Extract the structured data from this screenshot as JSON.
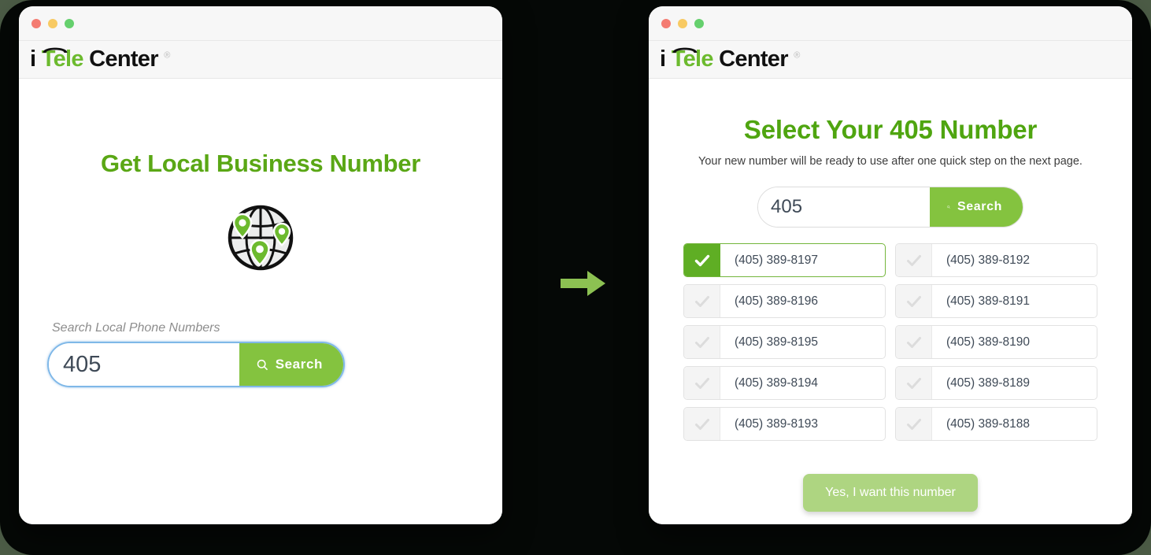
{
  "background": {
    "page_color": "#4c5c46",
    "panel_color": "#050806"
  },
  "theme": {
    "green_accent": "#84c33f",
    "green_heading": "#5aa715",
    "green_check": "#5fae24",
    "cta_green": "#aed581",
    "focus_blue": "#7fb8e8",
    "text_dark": "#3f4a57"
  },
  "logo": {
    "part_i": "i",
    "part_tele": "Tele",
    "part_center": "Center",
    "registered": "®",
    "handset_icon": "phone-handset-icon"
  },
  "window_controls": {
    "close": "close-dot",
    "minimize": "minimize-dot",
    "maximize": "maximize-dot"
  },
  "left_window": {
    "heading": "Get Local Business Number",
    "globe_icon": "globe-with-location-pins-icon",
    "field_label": "Search Local Phone Numbers",
    "search": {
      "value": "405",
      "placeholder": "Area code",
      "button_label": "Search",
      "icon": "search-icon",
      "focused": true
    }
  },
  "arrow": {
    "icon": "arrow-right-icon",
    "color": "#8cc152"
  },
  "right_window": {
    "heading": "Select Your 405 Number",
    "subheading": "Your new number will be ready to use after one quick step on the next page.",
    "search": {
      "value": "405",
      "placeholder": "Area code",
      "button_label": "Search",
      "icon": "search-icon",
      "focused": false
    },
    "numbers": [
      {
        "label": "(405) 389-8197",
        "selected": true
      },
      {
        "label": "(405) 389-8192",
        "selected": false
      },
      {
        "label": "(405) 389-8196",
        "selected": false
      },
      {
        "label": "(405) 389-8191",
        "selected": false
      },
      {
        "label": "(405) 389-8195",
        "selected": false
      },
      {
        "label": "(405) 389-8190",
        "selected": false
      },
      {
        "label": "(405) 389-8194",
        "selected": false
      },
      {
        "label": "(405) 389-8189",
        "selected": false
      },
      {
        "label": "(405) 389-8193",
        "selected": false
      },
      {
        "label": "(405) 389-8188",
        "selected": false
      }
    ],
    "cta_label": "Yes, I want this number"
  }
}
